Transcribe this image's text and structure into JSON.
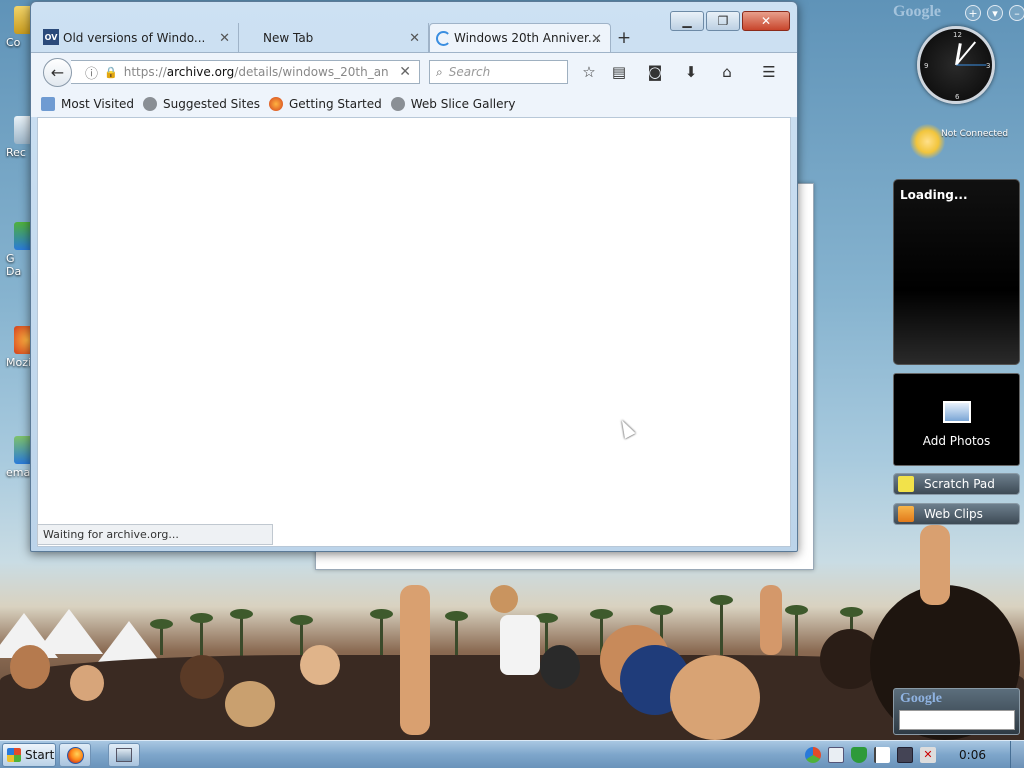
{
  "browser": {
    "tabs": [
      {
        "label": "Old versions of Windo...",
        "favicon": "OV",
        "state": "inactive"
      },
      {
        "label": "New Tab",
        "state": "inactive"
      },
      {
        "label": "Windows 20th Anniver...",
        "state": "active-loading"
      }
    ],
    "url": {
      "protocol": "https://",
      "host": "archive.org",
      "path": "/details/windows_20th_an"
    },
    "search_placeholder": "Search",
    "bookmarks": [
      {
        "label": "Most Visited",
        "icon": "most-visited-icon"
      },
      {
        "label": "Suggested Sites",
        "icon": "globe-icon"
      },
      {
        "label": "Getting Started",
        "icon": "firefox-icon"
      },
      {
        "label": "Web Slice Gallery",
        "icon": "globe-icon"
      }
    ],
    "status": "Waiting for archive.org..."
  },
  "desktop": {
    "icon_labels": [
      "Co",
      "Rec",
      "G\nDa",
      "Mozil",
      "ema"
    ]
  },
  "gadgets": {
    "google_logo": "Google",
    "weather_status": "Not Connected",
    "feed_status": "Loading...",
    "photos_label": "Add Photos",
    "scratch_pad": "Scratch Pad",
    "web_clips": "Web Clips",
    "search_logo": "Google"
  },
  "taskbar": {
    "start_label": "Start",
    "clock": "0:06"
  },
  "colors": {
    "accent": "#3a8ee0",
    "close_button": "#c8452c",
    "taskbar": "#7ea6cb"
  }
}
